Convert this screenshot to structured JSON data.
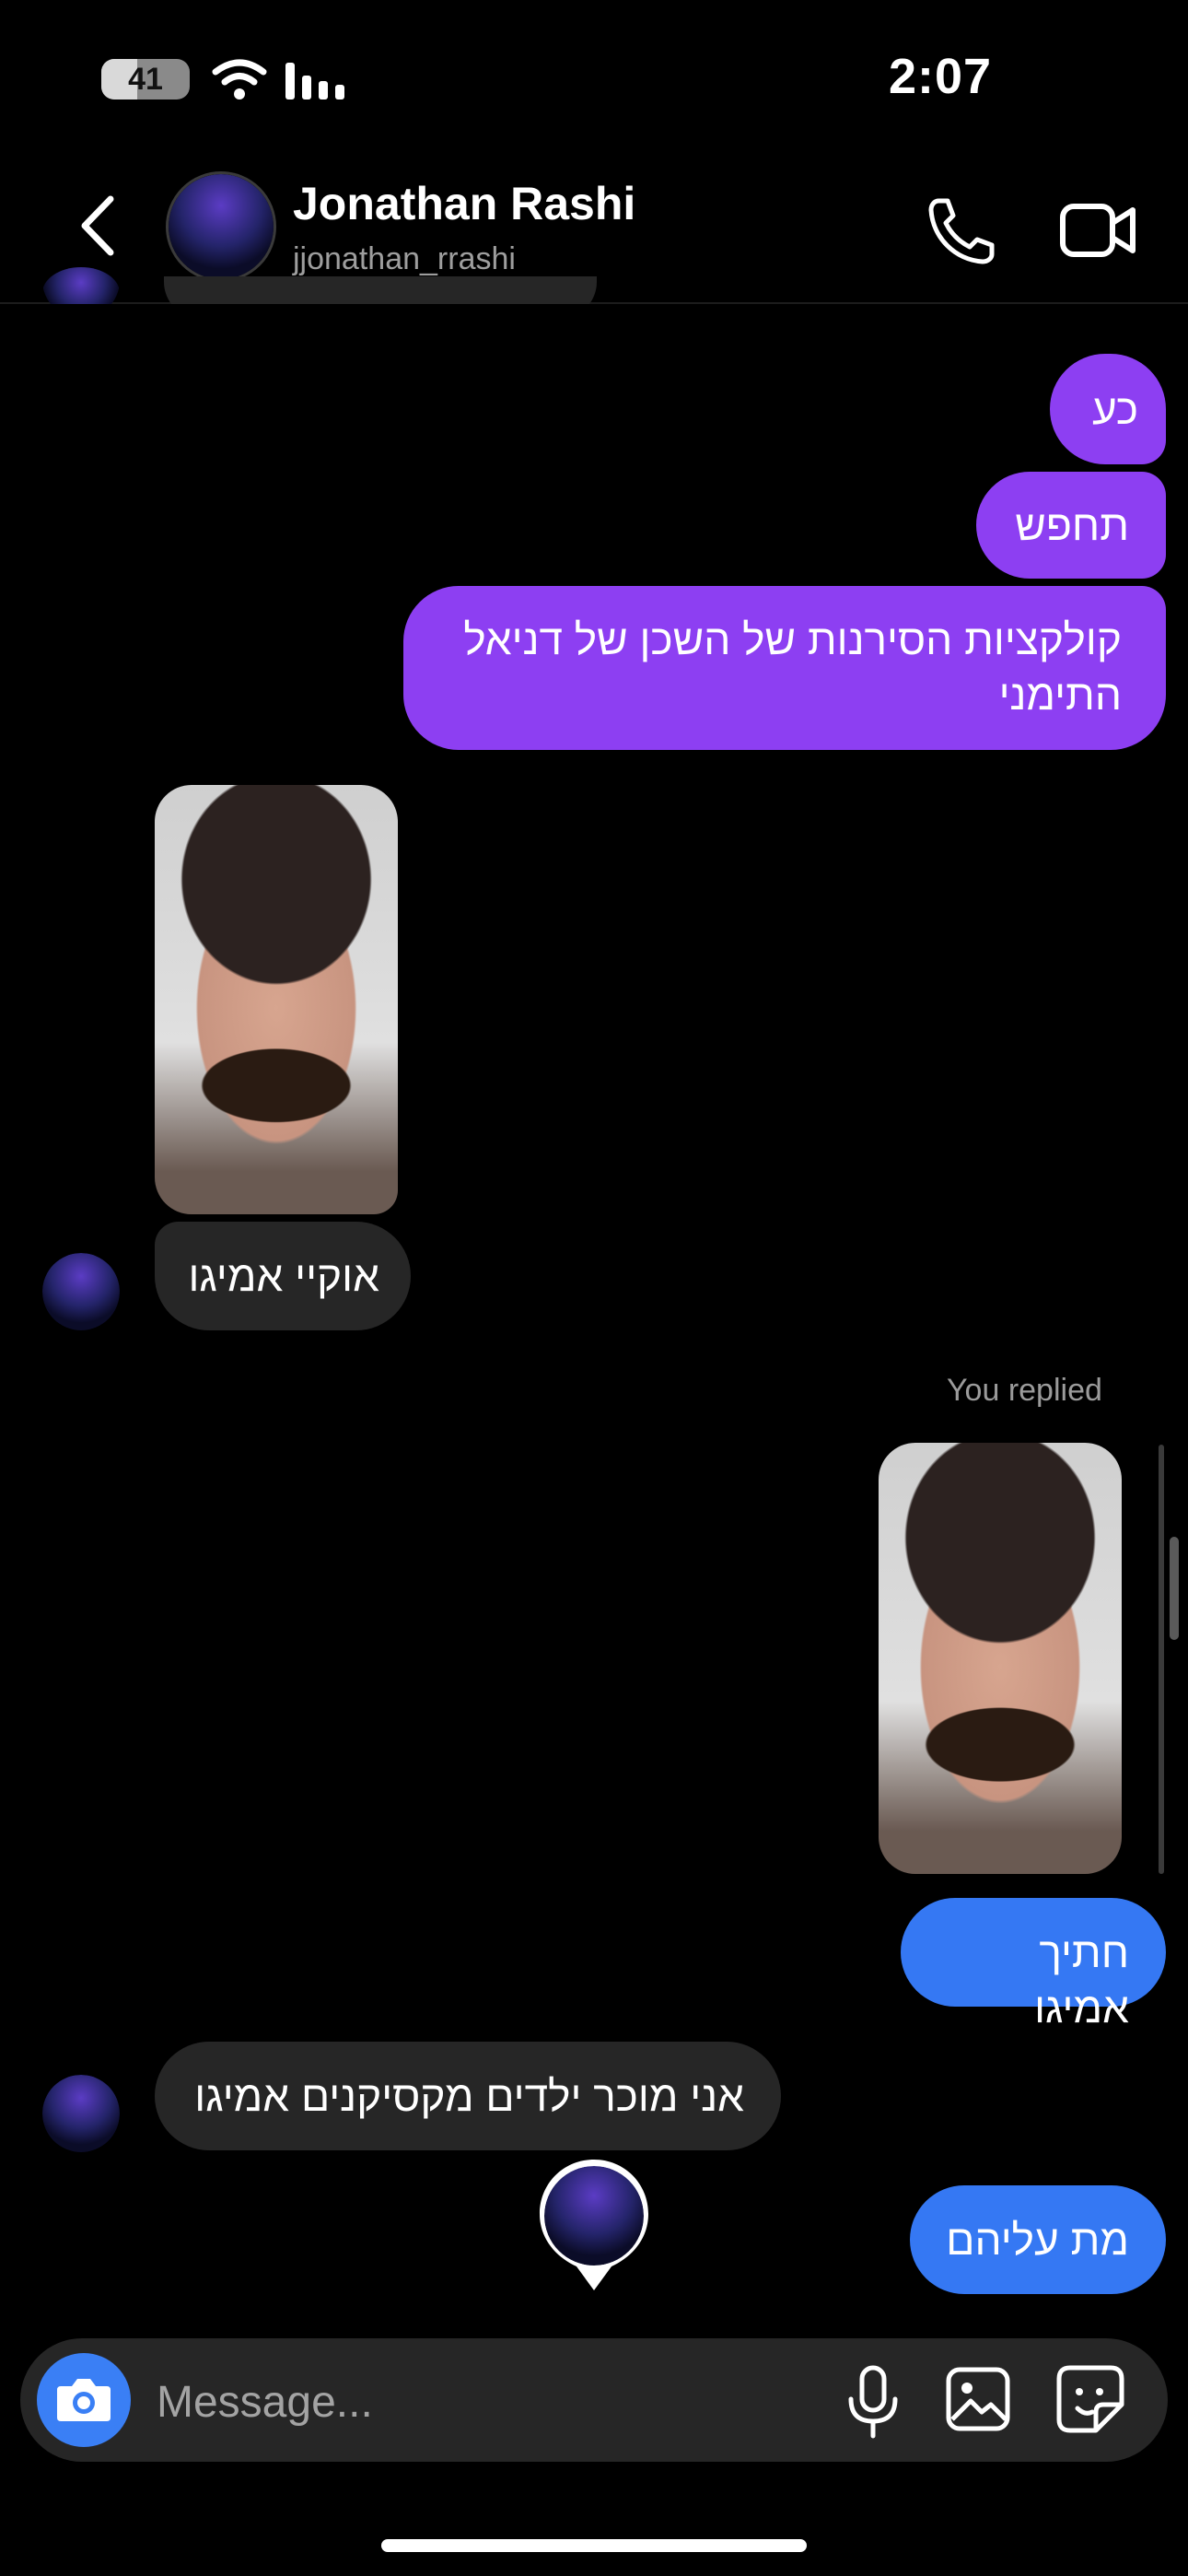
{
  "status_bar": {
    "time": "2:07",
    "battery": "41",
    "battery_level": 0.41
  },
  "header": {
    "name": "Jonathan Rashi",
    "username": "jjonathan_rrashi"
  },
  "messages": [
    {
      "side": "sent",
      "color": "#8d3ff2",
      "text": "כע"
    },
    {
      "side": "sent",
      "color": "#8d3ff2",
      "text": "תחפש"
    },
    {
      "side": "sent",
      "color": "#8d3ff2",
      "text": "קולקציות הסירנות של השכן של דניאל התימני"
    },
    {
      "side": "received",
      "type": "photo"
    },
    {
      "side": "received",
      "color": "#262626",
      "text": "אוקיי אמיגו"
    },
    {
      "side": "sent",
      "type": "reply_photo",
      "note": "You replied"
    },
    {
      "side": "sent",
      "color": "#3578f3",
      "text": "חתיך אמיגו"
    },
    {
      "side": "received",
      "color": "#262626",
      "text": "אני מוכר ילדים מקסיקנים אמיגו"
    },
    {
      "side": "sent",
      "color": "#3578f3",
      "text": "מת עליהם"
    }
  ],
  "composer": {
    "placeholder": "Message..."
  },
  "icons": {
    "back": "chevron-left-icon",
    "call": "phone-icon",
    "video": "video-camera-icon",
    "camera": "camera-icon",
    "mic": "microphone-icon",
    "gallery": "image-icon",
    "sticker": "sticker-icon"
  }
}
